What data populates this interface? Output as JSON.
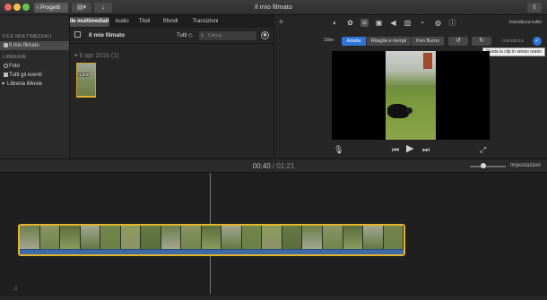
{
  "window": {
    "title": "Il mio filmato",
    "back_label": "Progetti"
  },
  "tabs": [
    {
      "label": "I miei file multimediali",
      "active": true
    },
    {
      "label": "Audio",
      "active": false
    },
    {
      "label": "Titoli",
      "active": false
    },
    {
      "label": "Sfondi",
      "active": false
    },
    {
      "label": "Transizioni",
      "active": false
    }
  ],
  "sidebar": {
    "section_media": "FILE MULTIMEDIALI",
    "project_item": "Il mio filmato",
    "section_libraries": "LIBRERIE",
    "library_items": [
      "Foto",
      "Tutti gli eventi"
    ],
    "library_name": "Libreria iMovie"
  },
  "browser": {
    "title": "Il mio filmato",
    "filter_label": "Tutti",
    "search_placeholder": "Cerca",
    "event_header": "6 apr 2016 (1)",
    "clip_duration": "1,3 m"
  },
  "viewer": {
    "reset_all_label": "Inizializza tutto",
    "style_label": "Stile:",
    "style_options": [
      {
        "label": "Adatta",
        "active": true
      },
      {
        "label": "Ritaglia e riempi",
        "active": false
      },
      {
        "label": "Ken Burns",
        "active": false
      }
    ],
    "reset_label": "Inizializza",
    "tooltip": "Ruota la clip in senso orario"
  },
  "timeline": {
    "current_time": "00:40",
    "separator": " / ",
    "total_time": "01:21",
    "settings_label": "Impostazioni"
  },
  "colors": {
    "accent": "#2f74d8",
    "clip_border": "#e3b32e",
    "audio": "#3f6aa8"
  }
}
